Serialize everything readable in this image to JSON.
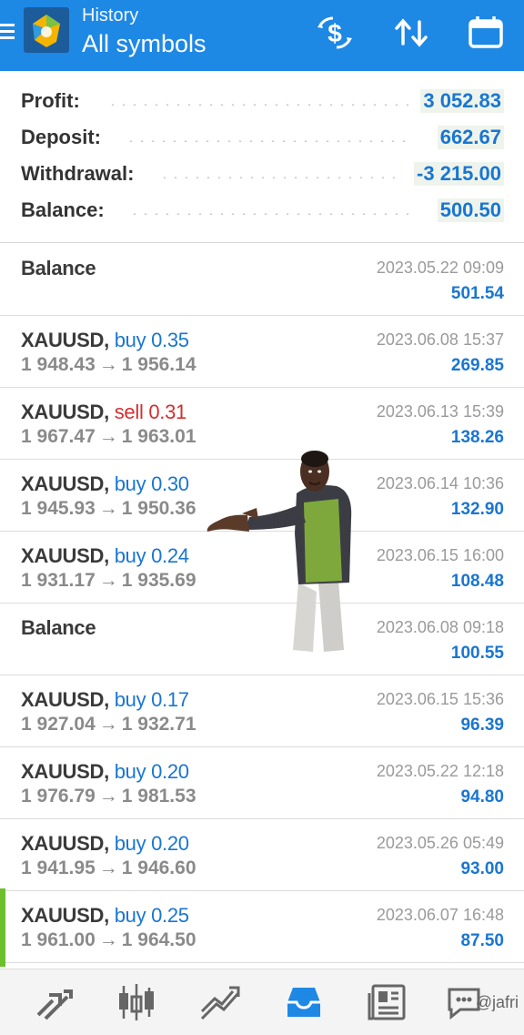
{
  "header": {
    "subtitle": "History",
    "title": "All symbols",
    "icons": [
      "menu-icon",
      "app-logo-icon",
      "deposit-withdraw-icon",
      "sort-icon",
      "calendar-icon"
    ]
  },
  "summary": {
    "rows": [
      {
        "label": "Profit:",
        "value": "3 052.83"
      },
      {
        "label": "Deposit:",
        "value": "662.67"
      },
      {
        "label": "Withdrawal:",
        "value": "-3 215.00"
      },
      {
        "label": "Balance:",
        "value": "500.50"
      }
    ]
  },
  "deals": [
    {
      "kind": "balance",
      "symbol": "Balance",
      "time": "2023.05.22 09:09",
      "profit": "501.54"
    },
    {
      "kind": "trade",
      "symbol": "XAUUSD,",
      "type": "buy 0.35",
      "side": "buy",
      "open": "1 948.43",
      "close": "1 956.14",
      "time": "2023.06.08 15:37",
      "profit": "269.85"
    },
    {
      "kind": "trade",
      "symbol": "XAUUSD,",
      "type": "sell 0.31",
      "side": "sell",
      "open": "1 967.47",
      "close": "1 963.01",
      "time": "2023.06.13 15:39",
      "profit": "138.26"
    },
    {
      "kind": "trade",
      "symbol": "XAUUSD,",
      "type": "buy 0.30",
      "side": "buy",
      "open": "1 945.93",
      "close": "1 950.36",
      "time": "2023.06.14 10:36",
      "profit": "132.90"
    },
    {
      "kind": "trade",
      "symbol": "XAUUSD,",
      "type": "buy 0.24",
      "side": "buy",
      "open": "1 931.17",
      "close": "1 935.69",
      "time": "2023.06.15 16:00",
      "profit": "108.48"
    },
    {
      "kind": "balance",
      "symbol": "Balance",
      "time": "2023.06.08 09:18",
      "profit": "100.55"
    },
    {
      "kind": "trade",
      "symbol": "XAUUSD,",
      "type": "buy 0.17",
      "side": "buy",
      "open": "1 927.04",
      "close": "1 932.71",
      "time": "2023.06.15 15:36",
      "profit": "96.39"
    },
    {
      "kind": "trade",
      "symbol": "XAUUSD,",
      "type": "buy 0.20",
      "side": "buy",
      "open": "1 976.79",
      "close": "1 981.53",
      "time": "2023.05.22 12:18",
      "profit": "94.80"
    },
    {
      "kind": "trade",
      "symbol": "XAUUSD,",
      "type": "buy 0.20",
      "side": "buy",
      "open": "1 941.95",
      "close": "1 946.60",
      "time": "2023.05.26 05:49",
      "profit": "93.00"
    },
    {
      "kind": "trade",
      "symbol": "XAUUSD,",
      "type": "buy 0.25",
      "side": "buy",
      "open": "1 961.00",
      "close": "1 964.50",
      "time": "2023.06.07 16:48",
      "profit": "87.50"
    }
  ],
  "price_arrow": "→",
  "bottom_nav": {
    "items": [
      "quotes-icon",
      "chart-candles-icon",
      "trade-icon",
      "history-inbox-icon",
      "news-icon",
      "chat-icon"
    ],
    "active": "history-inbox-icon"
  },
  "watermark": "@jafri",
  "colors": {
    "header_bg": "#1e88e5",
    "buy": "#1976d2",
    "sell": "#d32f2f",
    "profit": "#1976d2",
    "active_nav": "#1e88e5",
    "edge_marker": "#6cc02b"
  }
}
